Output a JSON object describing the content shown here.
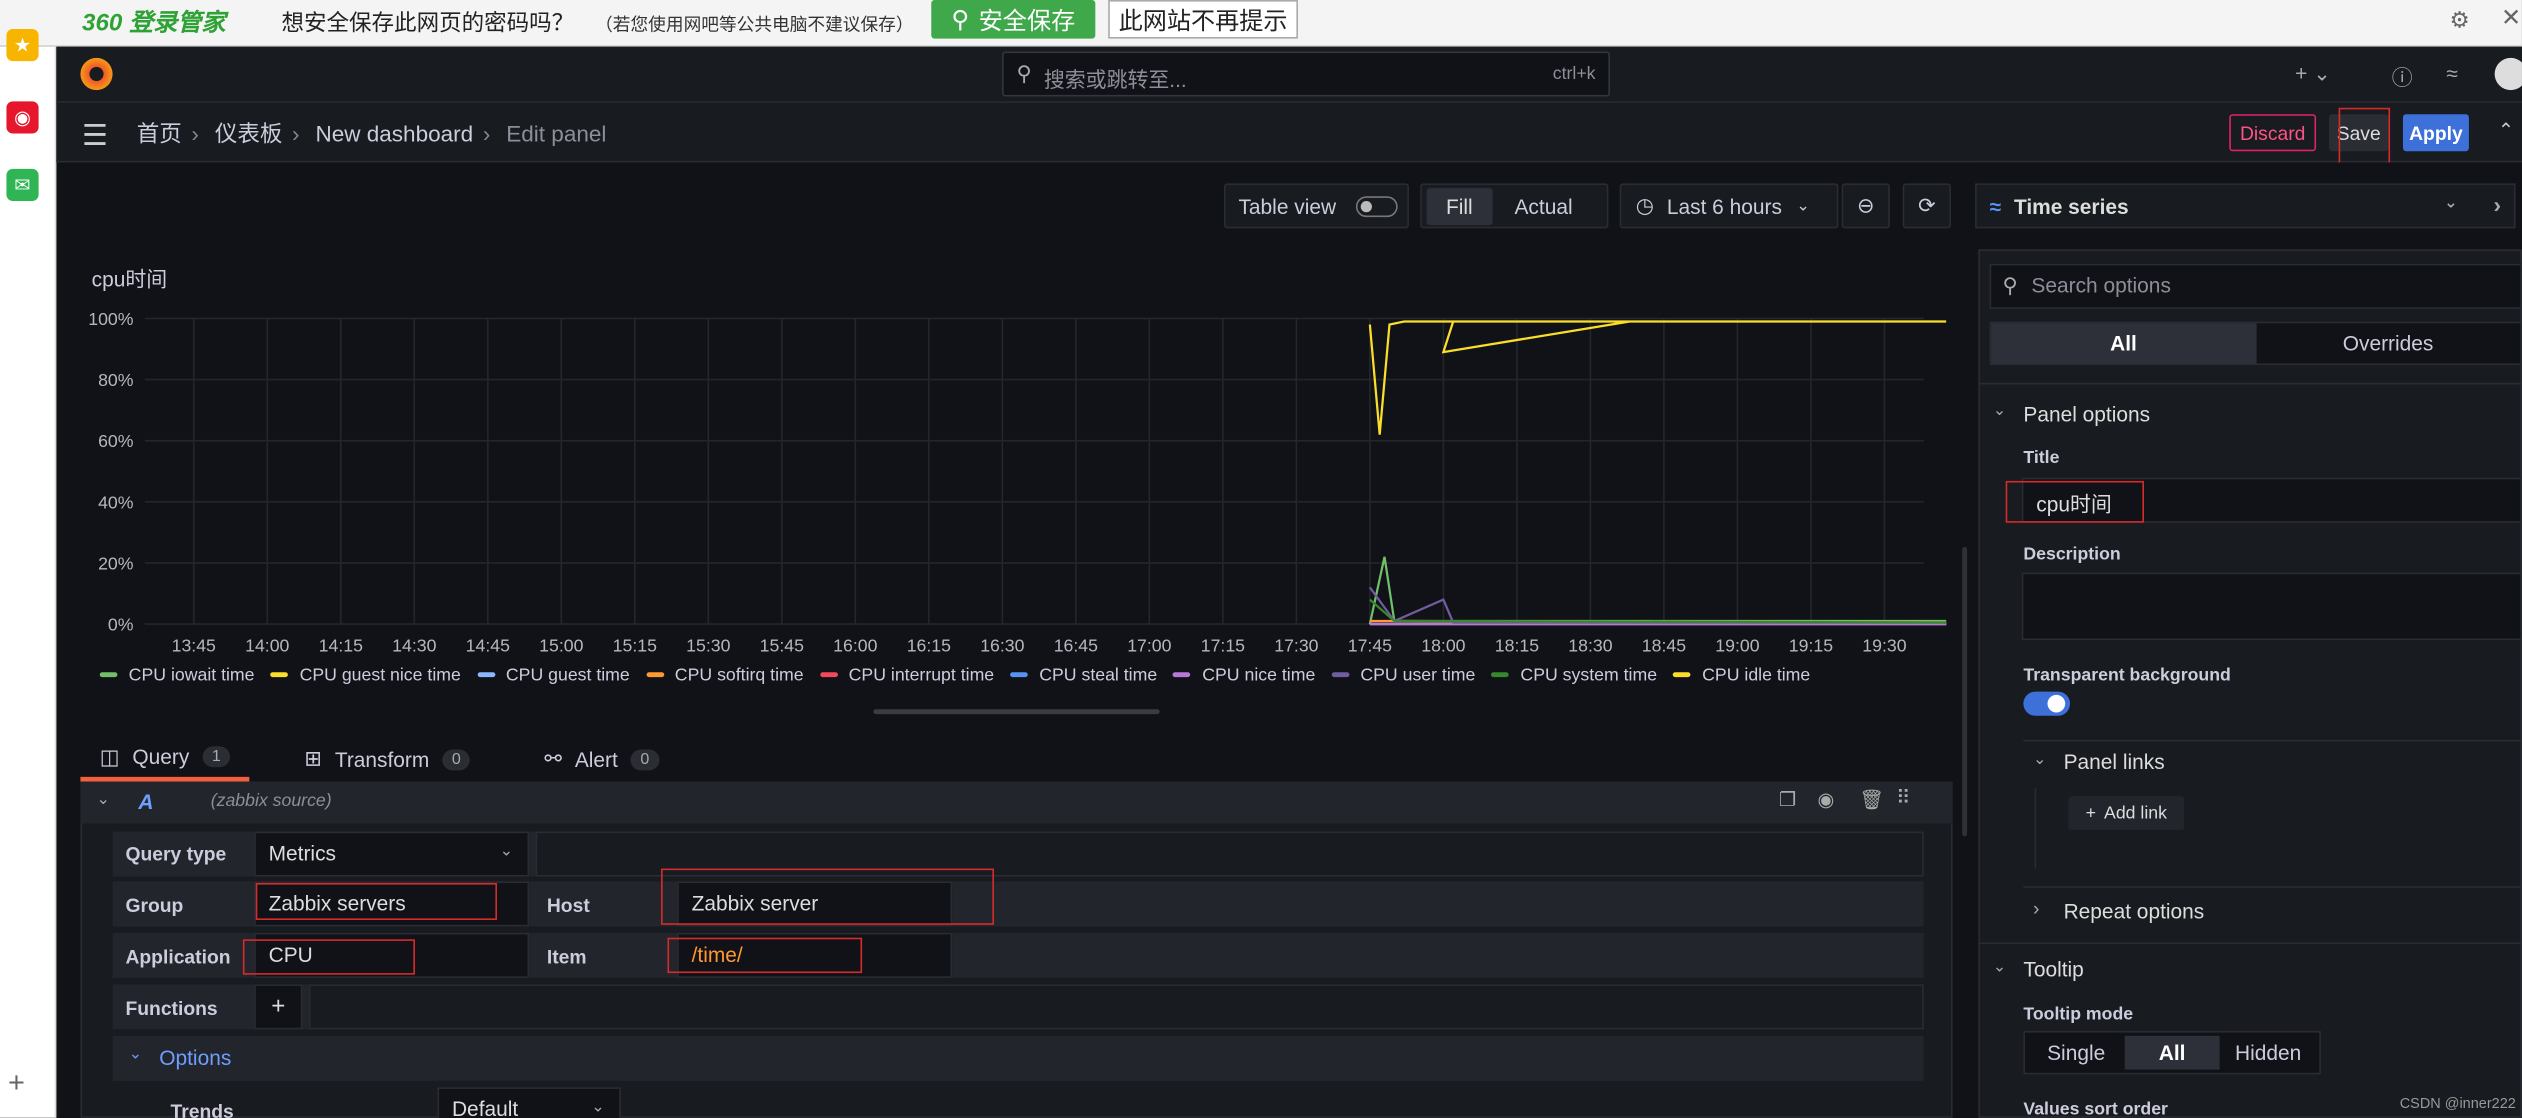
{
  "browser_bar": {
    "logo": "360 登录管家",
    "question": "想安全保存此网页的密码吗？",
    "hint": "（若您使用网吧等公共电脑不建议保存）",
    "save_label": "安全保存",
    "no_prompt_label": "此网站不再提示"
  },
  "topbar": {
    "search_placeholder": "搜索或跳转至...",
    "shortcut": "ctrl+k"
  },
  "breadcrumb": {
    "items": [
      "首页",
      "仪表板",
      "New dashboard",
      "Edit panel"
    ]
  },
  "actions": {
    "discard": "Discard",
    "save": "Save",
    "apply": "Apply"
  },
  "toolbar": {
    "table_view": "Table view",
    "fill": "Fill",
    "actual": "Actual",
    "time_range": "Last 6 hours"
  },
  "panel": {
    "title": "cpu时间"
  },
  "chart_data": {
    "type": "line",
    "title": "cpu时间",
    "ylim": [
      0,
      100
    ],
    "y_ticks": [
      "0%",
      "20%",
      "40%",
      "60%",
      "80%",
      "100%"
    ],
    "x_ticks": [
      "13:45",
      "14:00",
      "14:15",
      "14:30",
      "14:45",
      "15:00",
      "15:15",
      "15:30",
      "15:45",
      "16:00",
      "16:15",
      "16:30",
      "16:45",
      "17:00",
      "17:15",
      "17:30",
      "17:45",
      "18:00",
      "18:15",
      "18:30",
      "18:45",
      "19:00",
      "19:15",
      "19:30"
    ],
    "legend_position": "bottom",
    "series": [
      {
        "name": "CPU iowait time",
        "color": "#73bf69",
        "values": [
          [
            17.45,
            0
          ],
          [
            17.48,
            22
          ],
          [
            17.5,
            1
          ],
          [
            19.53,
            1
          ]
        ]
      },
      {
        "name": "CPU guest nice time",
        "color": "#fade2a",
        "values": [
          [
            17.45,
            0
          ],
          [
            19.53,
            0
          ]
        ]
      },
      {
        "name": "CPU guest time",
        "color": "#8ab8ff",
        "values": [
          [
            17.45,
            0
          ],
          [
            19.53,
            0
          ]
        ]
      },
      {
        "name": "CPU softirq time",
        "color": "#ff9830",
        "values": [
          [
            17.45,
            1
          ],
          [
            17.5,
            1
          ],
          [
            19.53,
            0.5
          ]
        ]
      },
      {
        "name": "CPU interrupt time",
        "color": "#f2495c",
        "values": [
          [
            17.45,
            0
          ],
          [
            19.53,
            0
          ]
        ]
      },
      {
        "name": "CPU steal time",
        "color": "#5794f2",
        "values": [
          [
            17.45,
            0
          ],
          [
            19.53,
            0
          ]
        ]
      },
      {
        "name": "CPU nice time",
        "color": "#b877d9",
        "values": [
          [
            17.45,
            0
          ],
          [
            19.53,
            0
          ]
        ]
      },
      {
        "name": "CPU user time",
        "color": "#705da0",
        "values": [
          [
            17.45,
            12
          ],
          [
            17.5,
            1
          ],
          [
            18.0,
            8
          ],
          [
            18.02,
            0.5
          ],
          [
            19.53,
            0.5
          ]
        ]
      },
      {
        "name": "CPU system time",
        "color": "#37872d",
        "values": [
          [
            17.45,
            8
          ],
          [
            17.5,
            1
          ],
          [
            19.53,
            0.5
          ]
        ]
      },
      {
        "name": "CPU idle time",
        "color": "#fade2a",
        "values": [
          [
            17.45,
            98
          ],
          [
            17.47,
            62
          ],
          [
            17.49,
            98
          ],
          [
            17.52,
            99
          ],
          [
            17.98,
            99
          ],
          [
            18.0,
            89
          ],
          [
            18.02,
            99
          ],
          [
            19.53,
            99
          ]
        ]
      }
    ]
  },
  "query_tabs": [
    {
      "label": "Query",
      "count": "1"
    },
    {
      "label": "Transform",
      "count": "0"
    },
    {
      "label": "Alert",
      "count": "0"
    }
  ],
  "query": {
    "ref": "A",
    "source": "(zabbix source)",
    "query_type_label": "Query type",
    "query_type_value": "Metrics",
    "group_label": "Group",
    "group_value": "Zabbix servers",
    "host_label": "Host",
    "host_value": "Zabbix server",
    "application_label": "Application",
    "application_value": "CPU",
    "item_label": "Item",
    "item_value": "/time/",
    "functions_label": "Functions",
    "options_label": "Options",
    "trends_label": "Trends",
    "trends_value": "Default"
  },
  "options_pane": {
    "viz_type": "Time series",
    "search_placeholder": "Search options",
    "tab_all": "All",
    "tab_overrides": "Overrides",
    "panel_options": "Panel options",
    "title_label": "Title",
    "title_value": "cpu时间",
    "description_label": "Description",
    "transparent_label": "Transparent background",
    "panel_links": "Panel links",
    "add_link": "Add link",
    "repeat_options": "Repeat options",
    "tooltip": "Tooltip",
    "tooltip_mode_label": "Tooltip mode",
    "tooltip_modes": [
      "Single",
      "All",
      "Hidden"
    ],
    "values_sort_order": "Values sort order"
  },
  "watermark": "CSDN @inner222"
}
